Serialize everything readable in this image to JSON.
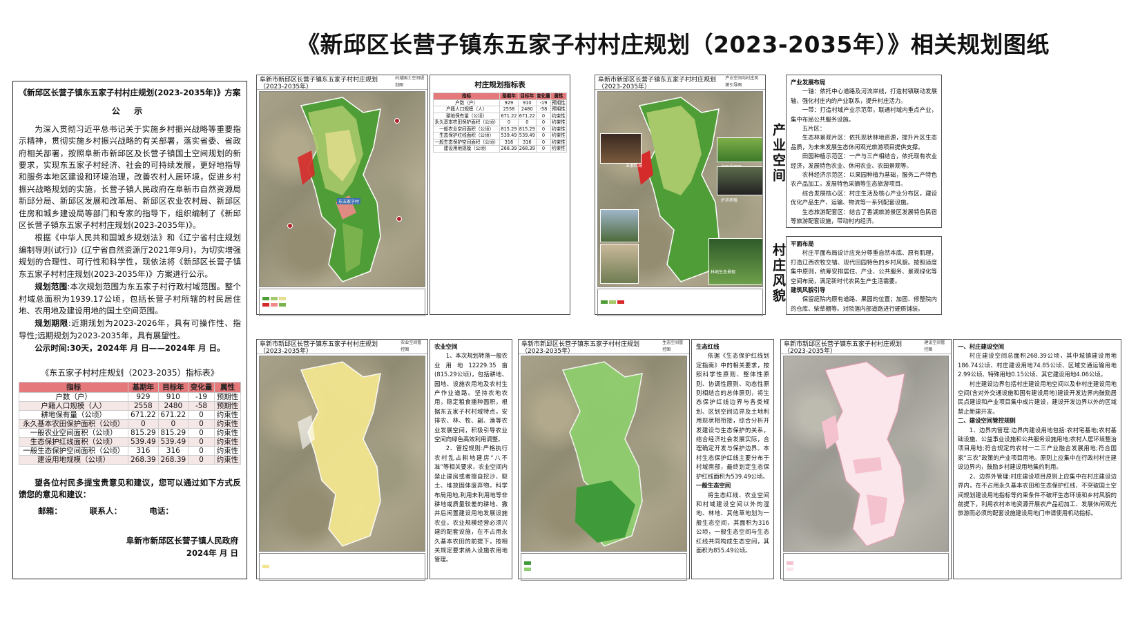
{
  "title": "《新邱区长营子镇东五家子村村庄规划（2023-2035年）》相关规划图纸",
  "notice": {
    "title": "《新邱区长营子镇东五家子村村庄规划(2023-2035年)》方案",
    "subtitle": "公 示",
    "p1": "为深入贯彻习近平总书记关于实施乡村振兴战略等重要指示精神，贯彻实施乡村振兴战略的有关部署，落实省委、省政府相关部署，按照阜新市新邱区及长营子镇国土空间规划的新要求，实现东五家子村经济、社会的可持续发展，更好地指导和服务本地区建设和环境治理，改善农村人居环境，促进乡村振兴战略规划的实施，长营子镇人民政府在阜新市自然资源局新邱分局、新邱区发展和改革局、新邱区农业农村局、新邱区住房和城乡建设局等部门和专家的指导下，组织编制了《新邱区长营子镇东五家子村村庄规划(2023-2035年)》。",
    "p2": "根据《中华人民共和国城乡规划法》和《辽宁省村庄规划编制导则(试行)》(辽宁省自然资源厅2021年9月)，为切实增强规划的合理性、可行性和科学性，现依法将《新邱区长营子镇东五家子村村庄规划(2023-2035年)》方案进行公示。",
    "scope_label": "规划范围",
    "scope_text": ":本次规划范围为东五家子村行政村域范围。整个村域总面积为1939.17公顷，包括长营子村所辖的村民居住地、农用地及建设用地的国土空间范围。",
    "period_label": "规划期限",
    "period_text": ":近期规划为2023-2026年，具有可操作性、指导性;远期规划为2023-2035年，具有展望性。",
    "time_label": "公示时间",
    "time_text": ":30天，2024年 月 日——2024年 月 日。",
    "table_title": "《东五家子村村庄规划（2023-2035）指标表》",
    "closing": "望各位村民多提宝贵意见和建议，您可以通过如下方式反馈您的意见和建议：",
    "contact": [
      "邮箱：",
      "联系人：",
      "电话："
    ],
    "org": "阜新市新邱区长营子镇人民政府",
    "date": "2024年 月 日"
  },
  "indicator_table": {
    "headers": [
      "指标",
      "基期年",
      "目标年",
      "变化量",
      "属性"
    ],
    "rows": [
      [
        "户数（户）",
        "929",
        "910",
        "-19",
        "预期性"
      ],
      [
        "户籍人口规模（人）",
        "2558",
        "2480",
        "-58",
        "预期性"
      ],
      [
        "耕地保有量（公顷）",
        "671.22",
        "671.22",
        "0",
        "约束性"
      ],
      [
        "永久基本农田保护面积（公顷）",
        "0",
        "0",
        "0",
        "约束性"
      ],
      [
        "一般农业空间面积（公顷）",
        "815.29",
        "815.29",
        "0",
        "约束性"
      ],
      [
        "生态保护红线面积（公顷）",
        "539.49",
        "539.49",
        "0",
        "约束性"
      ],
      [
        "一般生态保护空间面积（公顷）",
        "316",
        "316",
        "0",
        "约束性"
      ],
      [
        "建设用地规模（公顷）",
        "268.39",
        "268.39",
        "0",
        "约束性"
      ]
    ]
  },
  "small_table_title": "村庄规划指标表",
  "maps": {
    "m1": {
      "title": "阜新市新邱区长营子镇东五家子村村庄规划（2023-2035年）",
      "sub": "村域国土空间规划图"
    },
    "m2": {
      "title": "阜新市新邱区长营子镇东五家子村村庄规划（2023-2035年）",
      "sub": "产业空间与村庄风貌引导图"
    },
    "m3": {
      "title": "阜新市新邱区长营子镇东五家子村村庄规划（2023-2035年）",
      "sub": "农业空间管控图"
    },
    "m4": {
      "title": "阜新市新邱区长营子镇东五家子村村庄规划（2023-2035年）",
      "sub": "生态空间管控图"
    },
    "m5": {
      "title": "阜新市新邱区长营子镇东五家子村村庄规划（2023-2035年）",
      "sub": "建设空间管控图"
    }
  },
  "vertical_labels": {
    "industry": "产业空间",
    "style": "村庄风貌"
  },
  "industry": {
    "heading": "产业发展布局",
    "items": [
      "一轴：依托中心道路及河流岸线，打造村镇联动发展轴，强化村庄内的产业联系，提升村庄活力。",
      "一带：打造村域产业示范带，联通村域内重点产业，集中布局公共服务设施。",
      "五片区：",
      "生态林景观片区：依托现状林地资源，提升片区生态品质，为未来发展生态休闲观光旅游项目提供支撑。",
      "田园种植示范区：一产与三产相结合，依托现有农业经济，发展特色农业、休闲农业、农田景观等。",
      "农林经济示范区：以果园种植为基础，服务二产特色农产品加工，发展特色采摘等生态旅游项目。",
      "综合发展核心区：村庄生活及核心产业分布区，建设优化产品生产、运输、物流等一系列配套设施。",
      "生态旅游配套区：结合了香湖旅游景区发展特色民宿等旅游配套设施，带动村内经济。"
    ]
  },
  "style": {
    "heading1": "平面布局",
    "text1": "村庄平面布局设计应充分尊重自然本底、原有肌理，打造辽西农牧交错、现代田园特色的乡村风貌。按照适度集中原则，统筹安排居住、产业、公共服务、景观绿化等空间布局，满足新时代农民生产生活需要。",
    "heading2": "建筑风貌引导",
    "text2": "保留庭院内原有道路、果园的位置；加固、修整院内的仓库、柴草棚等。对院落内部道路进行硬质铺装。"
  },
  "agri": {
    "heading": "农业空间",
    "text1": "1、本次规划转落一般农业用地12229.35亩(815.29公顷)，包括耕地、园地、设施农用地及农村生产作业道路。坚持农地农用，稳定粮食播种面积，根据东五家子村村域特点，安排农、林、牧、副、渔等农业发展空间，积极引导农业空间向绿色高效利用调整。",
    "text2": "2、管控规则:严格执行农村乱占耕地建房“八不准”等相关要求，农业空间内禁止建房或者擅自挖沙、取土、堆放固体废弃物。科学布局用地,利用未利用地等非耕地或质量较差的耕地、撤并后闲置建设用地发展设施农业。农业规模经营必须兴建的配套设施，在不占用永久基本农田的前提下，按相关规定要求纳入设施农用地管理。"
  },
  "eco": {
    "heading": "生态红线",
    "text1": "依据《生态保护红线划定指南》中的相关要求，按照科学性原则、整体性原则、协调性原则、动态性原则相结合的总体原则，将生态保护红线边界与各类规划、区划空间边界及土地利用现状相衔接，综合分析开发建设与生态保护的关系，结合经济社会发展实际，合理确定开发与保护边界。本村生态保护红线主要分布于村域南部，最终划定生态保护红线面积为539.49公顷。",
    "heading2": "一般生态空间",
    "text2": "将生态红线、农业空间和村域建设空间以外的湿地、林地、其他草地划为一般生态空间，其面积为316公顷，一般生态空间与生态红线共同构成生态空间，其面积为855.49公顷。"
  },
  "build": {
    "heading1": "一、村庄建设空间",
    "text1": "村庄建设空间总面积268.39公顷，其中城镇建设用地186.74公顷、村庄建设用地74.85公顷、区域交通运输用地2.99公顷、特殊用地0.15公顷、其它建设用地4.06公顷。",
    "text2": "村庄建设边界包括村庄建设用地空间以及非村庄建设用地空间(含对外交通设施和国有建设用地)建设开发边界内鼓励居民点建设和产业项目集中成片建设，建设开发边界以外的区域禁止新建开发。",
    "heading2": "二、建设空间管控规则",
    "text3": "1、边界内管理:边界内建设用地包括:农村宅基地;农村基础设施、公益事业设施和公共服务设施用地;农村人居环境整治项目用地;符合规定的农村一二三产业融合发展用地;符合国家“三农”政策的产业项目用地。原则上应集中在行政村村庄建设边界内，鼓励乡村建设用地集约利用。",
    "text4": "2、边界外管理:村庄建设项目原则上应集中在村庄建设边界内，在不占用永久基本农田和生态保护红线、不突破国土空间规划建设用地指标等约束条件不破坏生态环境和乡村风貌的前提下，利用农村本地资源开展农产品初加工、发展休闲观光旅游而必须的配套设施建设用地门申请使用机动指标。"
  },
  "photo_labels": [
    "五家红海",
    "海田景观区",
    "护坊养殖",
    "林地生态景观"
  ],
  "village_label": "东五家子村",
  "colors": {
    "table_header": "#e4787a",
    "red_line": "#d62b2b",
    "agri": "#f2e58f",
    "eco_dark": "#3f9a3a",
    "eco_light": "#8fd06e",
    "build": "#f4c2cf"
  }
}
